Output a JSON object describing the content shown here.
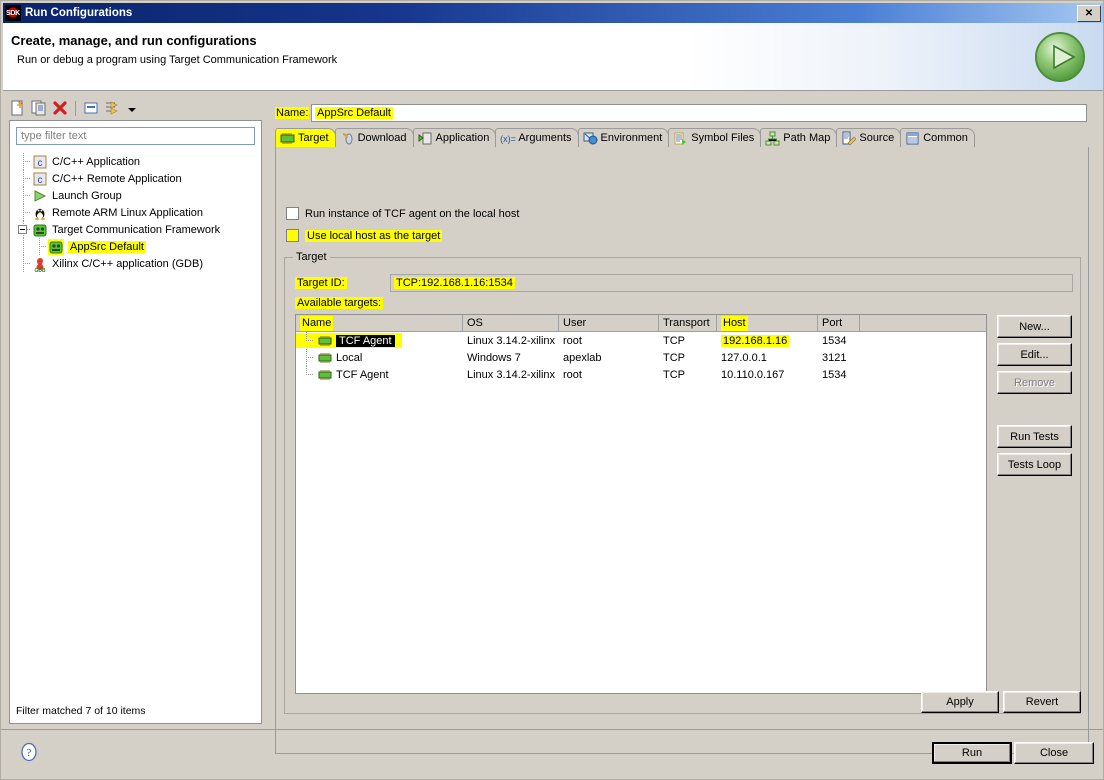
{
  "window": {
    "title": "Run Configurations",
    "icon": "sdk-icon",
    "close_label": "✕"
  },
  "header": {
    "title": "Create, manage, and run configurations",
    "subtitle": "Run or debug a program using Target Communication Framework",
    "run_icon": "run-green-play-icon"
  },
  "left_panel": {
    "toolbar": [
      {
        "name": "new-launch-configuration-icon",
        "tooltip": "New"
      },
      {
        "name": "duplicate-icon",
        "tooltip": "Duplicate"
      },
      {
        "name": "delete-red-x-icon",
        "tooltip": "Delete"
      },
      {
        "name": "collapse-all-icon",
        "tooltip": "Collapse All"
      },
      {
        "name": "filter-icon",
        "tooltip": "Filter"
      },
      {
        "name": "chevron-down-icon",
        "tooltip": "Menu"
      }
    ],
    "filter_placeholder": "type filter text",
    "tree": [
      {
        "label": "C/C++ Application",
        "icon": "c-app-icon",
        "level": 1,
        "selected": false,
        "expandable": false
      },
      {
        "label": "C/C++ Remote Application",
        "icon": "c-app-icon",
        "level": 1,
        "selected": false,
        "expandable": false
      },
      {
        "label": "Launch Group",
        "icon": "launch-group-icon",
        "level": 1,
        "selected": false,
        "expandable": false
      },
      {
        "label": "Remote ARM Linux Application",
        "icon": "linux-penguin-icon",
        "level": 1,
        "selected": false,
        "expandable": false
      },
      {
        "label": "Target Communication Framework",
        "icon": "tcf-icon",
        "level": 1,
        "selected": false,
        "expandable": true
      },
      {
        "label": "AppSrc Default",
        "icon": "tcf-icon",
        "level": 2,
        "selected": true,
        "expandable": false
      },
      {
        "label": "Xilinx C/C++ application (GDB)",
        "icon": "gdb-icon",
        "level": 1,
        "selected": false,
        "expandable": false
      }
    ],
    "filter_status": "Filter matched 7 of 10 items"
  },
  "right_panel": {
    "name_label": "Name:",
    "name_value": "AppSrc Default",
    "tabs": [
      {
        "label": "Target",
        "icon": "target-chip-icon",
        "active": true
      },
      {
        "label": "Download",
        "icon": "download-icon",
        "active": false
      },
      {
        "label": "Application",
        "icon": "application-icon",
        "active": false
      },
      {
        "label": "Arguments",
        "icon": "arguments-icon",
        "active": false
      },
      {
        "label": "Environment",
        "icon": "environment-icon",
        "active": false
      },
      {
        "label": "Symbol Files",
        "icon": "symbol-files-icon",
        "active": false
      },
      {
        "label": "Path Map",
        "icon": "path-map-icon",
        "active": false
      },
      {
        "label": "Source",
        "icon": "source-icon",
        "active": false
      },
      {
        "label": "Common",
        "icon": "common-icon",
        "active": false
      }
    ],
    "checkboxes": [
      {
        "label": "Run instance of TCF agent on the local host",
        "checked": false,
        "highlighted": false
      },
      {
        "label": "Use local host as the target",
        "checked": false,
        "highlighted": true
      }
    ],
    "target_group": {
      "title": "Target",
      "target_id_label": "Target ID:",
      "target_id_value": "TCP:192.168.1.16:1534",
      "available_label": "Available targets:",
      "columns": [
        "Name",
        "OS",
        "User",
        "Transport",
        "Host",
        "Port",
        ""
      ],
      "rows": [
        {
          "name": "TCF Agent",
          "os": "Linux 3.14.2-xilinx",
          "user": "root",
          "transport": "TCP",
          "host": "192.168.1.16",
          "port": "1534",
          "selected": true,
          "host_highlighted": true
        },
        {
          "name": "Local",
          "os": "Windows 7",
          "user": "apexlab",
          "transport": "TCP",
          "host": "127.0.0.1",
          "port": "3121",
          "selected": false,
          "host_highlighted": false
        },
        {
          "name": "TCF Agent",
          "os": "Linux 3.14.2-xilinx",
          "user": "root",
          "transport": "TCP",
          "host": "10.110.0.167",
          "port": "1534",
          "selected": false,
          "host_highlighted": false
        }
      ],
      "buttons": [
        {
          "label": "New...",
          "enabled": true
        },
        {
          "label": "Edit...",
          "enabled": true
        },
        {
          "label": "Remove",
          "enabled": false
        },
        {
          "label": "Run Tests",
          "enabled": true
        },
        {
          "label": "Tests Loop",
          "enabled": true
        }
      ]
    }
  },
  "footer": {
    "apply_label": "Apply",
    "revert_label": "Revert",
    "run_label": "Run",
    "close_label": "Close",
    "help_icon": "help-question-icon"
  },
  "colors": {
    "highlight": "#ffff00",
    "dialog_bg": "#d4d0c8",
    "title_bar": "#0a246a",
    "selection": "#000000"
  }
}
